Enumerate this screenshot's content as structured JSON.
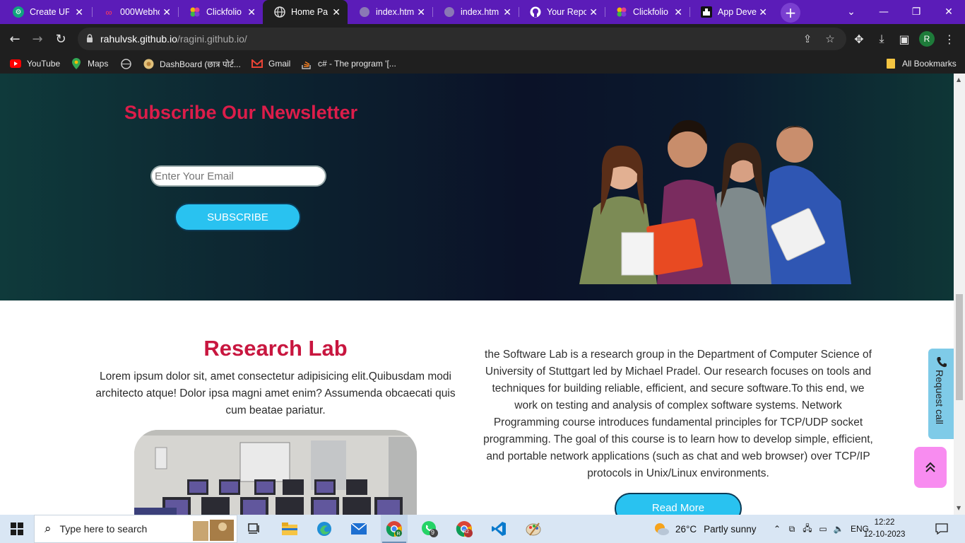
{
  "browser": {
    "tabs": [
      {
        "label": "Create UP",
        "icon": "chatgpt-icon",
        "active": false
      },
      {
        "label": "000Webho",
        "icon": "webhost-icon",
        "active": false
      },
      {
        "label": "Clickfolio",
        "icon": "clickfolio-icon",
        "active": false
      },
      {
        "label": "Home Pag",
        "icon": "globe-icon",
        "active": true
      },
      {
        "label": "index.htm",
        "icon": "globe-icon",
        "active": false
      },
      {
        "label": "index.htm",
        "icon": "globe-icon",
        "active": false
      },
      {
        "label": "Your Repo",
        "icon": "github-icon",
        "active": false
      },
      {
        "label": "Clickfolio",
        "icon": "clickfolio-icon",
        "active": false
      },
      {
        "label": "App Deve",
        "icon": "app-icon",
        "active": false
      }
    ],
    "url_host": "rahulvsk.github.io",
    "url_path": "/ragini.github.io/",
    "profile_initial": "R",
    "bookmarks": [
      {
        "label": "YouTube",
        "icon": "youtube-icon"
      },
      {
        "label": "Maps",
        "icon": "maps-icon"
      },
      {
        "label": "",
        "icon": "globe-icon"
      },
      {
        "label": "DashBoard (छात्र पोर्ट...",
        "icon": "dashboard-icon"
      },
      {
        "label": "Gmail",
        "icon": "gmail-icon"
      },
      {
        "label": "c# - The program '[...",
        "icon": "stackoverflow-icon"
      }
    ],
    "all_bookmarks": "All Bookmarks"
  },
  "newsletter": {
    "title": "Subscribe Our Newsletter",
    "email_placeholder": "Enter Your Email",
    "button": "SUBSCRIBE"
  },
  "research": {
    "title": "Research Lab",
    "lead": "Lorem ipsum dolor sit, amet consectetur adipisicing elit.Quibusdam modi architecto atque! Dolor ipsa magni amet enim? Assumenda obcaecati quis cum beatae pariatur.",
    "description": "the Software Lab is a research group in the Department of Computer Science of University of Stuttgart led by Michael Pradel. Our research focuses on tools and techniques for building reliable, efficient, and secure software.To this end, we work on testing and analysis of complex software systems. Network Programming course introduces fundamental principles for TCP/UDP socket programming. The goal of this course is to learn how to develop simple, efficient, and portable network applications (such as chat and web browser) over TCP/IP protocols in Unix/Linux environments.",
    "read_more": "Read More"
  },
  "floating": {
    "request_call": "Request call"
  },
  "taskbar": {
    "search_placeholder": "Type here to search",
    "weather_temp": "26°C",
    "weather_desc": "Partly sunny",
    "language": "ENG",
    "time": "12:22",
    "date": "12-10-2023",
    "whatsapp_badge": "9",
    "chrome_profile_badge": "R2"
  },
  "colors": {
    "tab_strip": "#5b1cb8",
    "accent_red": "#dc1d4a",
    "button_blue": "#29c2f0",
    "to_top_pink": "#f88cf0"
  }
}
